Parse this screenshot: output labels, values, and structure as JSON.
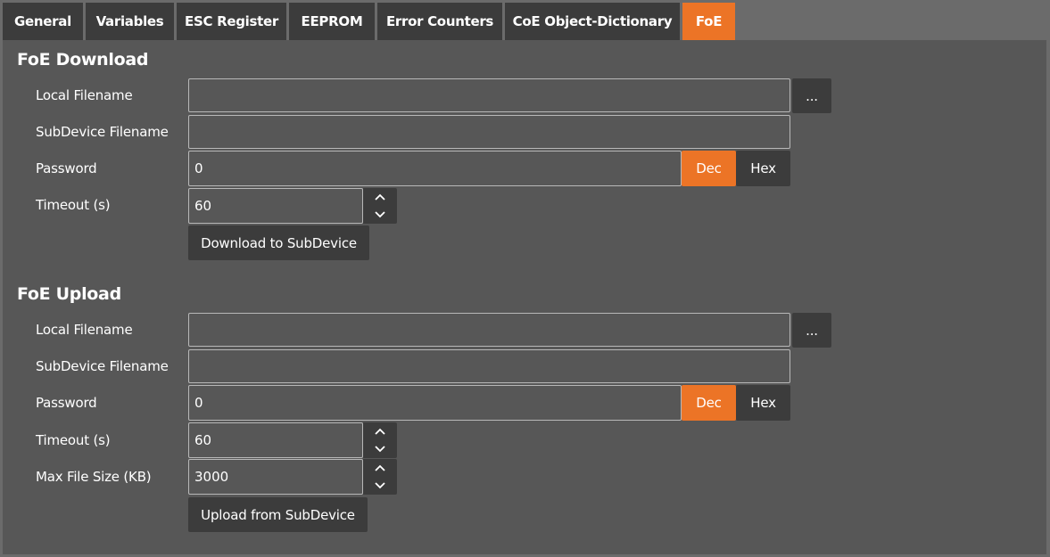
{
  "tabs": [
    {
      "label": "General"
    },
    {
      "label": "Variables"
    },
    {
      "label": "ESC Register"
    },
    {
      "label": "EEPROM"
    },
    {
      "label": "Error Counters"
    },
    {
      "label": "CoE Object-Dictionary"
    },
    {
      "label": "FoE"
    }
  ],
  "active_tab": "FoE",
  "accent_color": "#ec7426",
  "download": {
    "title": "FoE Download",
    "local_filename_label": "Local Filename",
    "local_filename_value": "",
    "browse_label": "...",
    "subdevice_filename_label": "SubDevice Filename",
    "subdevice_filename_value": "",
    "password_label": "Password",
    "password_value": "0",
    "dec_label": "Dec",
    "hex_label": "Hex",
    "timeout_label": "Timeout (s)",
    "timeout_value": "60",
    "action_label": "Download to SubDevice"
  },
  "upload": {
    "title": "FoE Upload",
    "local_filename_label": "Local Filename",
    "local_filename_value": "",
    "browse_label": "...",
    "subdevice_filename_label": "SubDevice Filename",
    "subdevice_filename_value": "",
    "password_label": "Password",
    "password_value": "0",
    "dec_label": "Dec",
    "hex_label": "Hex",
    "timeout_label": "Timeout (s)",
    "timeout_value": "60",
    "max_size_label": "Max File Size (KB)",
    "max_size_value": "3000",
    "action_label": "Upload from SubDevice"
  }
}
